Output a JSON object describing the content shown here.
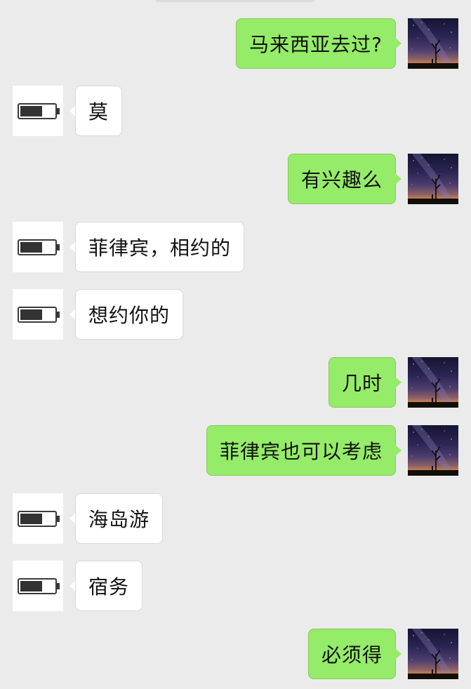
{
  "colors": {
    "background": "#ebebeb",
    "sent_bubble": "#95ec69",
    "received_bubble": "#ffffff"
  },
  "avatars": {
    "self": "night-sky-tree-avatar",
    "contact": "battery-icon-avatar"
  },
  "messages": [
    {
      "side": "sent",
      "text": "马来西亚去过?"
    },
    {
      "side": "received",
      "text": "莫"
    },
    {
      "side": "sent",
      "text": "有兴趣么"
    },
    {
      "side": "received",
      "text": "菲律宾，相约的"
    },
    {
      "side": "received",
      "text": "想约你的"
    },
    {
      "side": "sent",
      "text": "几时"
    },
    {
      "side": "sent",
      "text": "菲律宾也可以考虑"
    },
    {
      "side": "received",
      "text": "海岛游"
    },
    {
      "side": "received",
      "text": "宿务"
    },
    {
      "side": "sent",
      "text": "必须得"
    }
  ]
}
